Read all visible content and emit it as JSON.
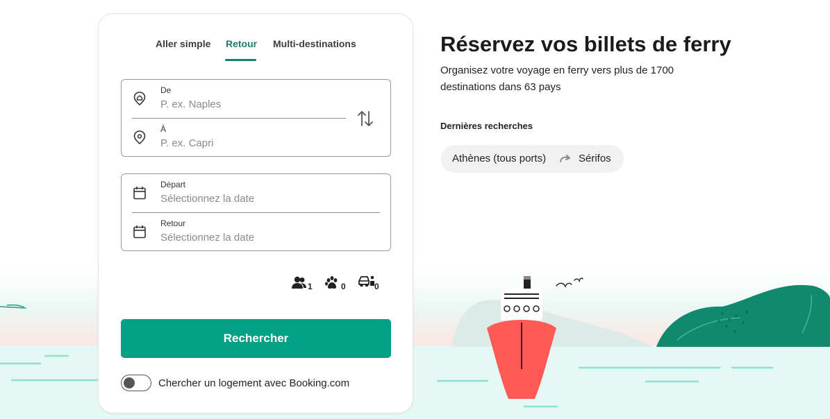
{
  "tabs": [
    {
      "label": "Aller simple",
      "active": false
    },
    {
      "label": "Retour",
      "active": true
    },
    {
      "label": "Multi-destinations",
      "active": false
    }
  ],
  "route": {
    "from": {
      "label": "De",
      "placeholder": "P. ex. Naples"
    },
    "to": {
      "label": "À",
      "placeholder": "P. ex. Capri"
    }
  },
  "dates": {
    "departure": {
      "label": "Départ",
      "placeholder": "Sélectionnez la date"
    },
    "return": {
      "label": "Retour",
      "placeholder": "Sélectionnez la date"
    }
  },
  "counters": {
    "passengers": {
      "icon": "passengers-icon",
      "value": "1"
    },
    "pets": {
      "icon": "paw-icon",
      "value": "0"
    },
    "vehicles": {
      "icon": "vehicle-icon",
      "value": "0"
    }
  },
  "search_button": "Rechercher",
  "booking_toggle": {
    "label": "Chercher un logement avec Booking.com",
    "on": false
  },
  "hero": {
    "title": "Réservez vos billets de ferry",
    "subtitle": "Organisez votre voyage en ferry vers plus de 1700 destinations dans 63 pays"
  },
  "recent": {
    "title": "Dernières recherches",
    "items": [
      {
        "from": "Athènes (tous ports)",
        "to": "Sérifos"
      }
    ]
  },
  "colors": {
    "accent": "#1a7f6b",
    "button": "#02a185",
    "ship_hull": "#ff5a55",
    "island": "#0f8a6d",
    "sea": "#dff7f2"
  }
}
